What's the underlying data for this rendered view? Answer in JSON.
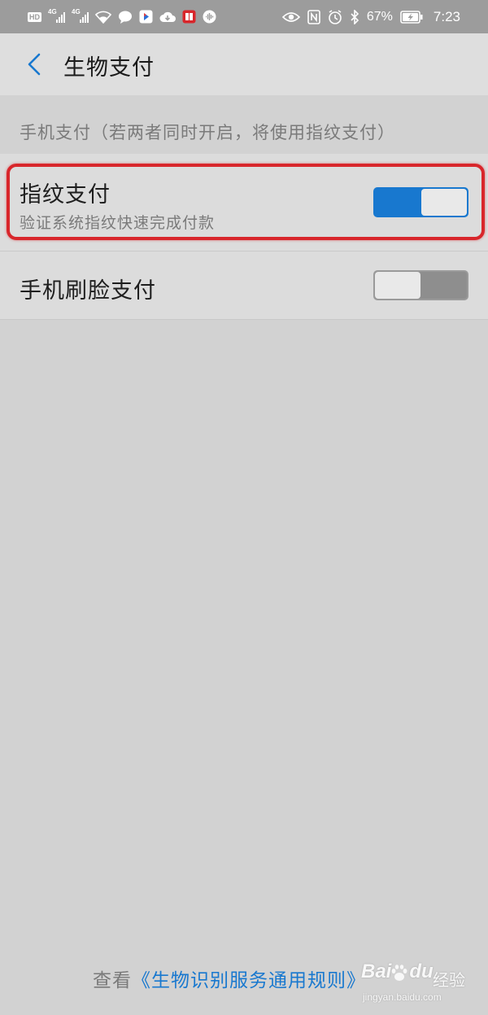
{
  "status_bar": {
    "hd_label": "HD",
    "network_1": "4G",
    "network_2": "4G",
    "battery_percent": "67%",
    "time": "7:23",
    "icons_left": [
      "hd-icon",
      "signal-icon",
      "signal-icon",
      "wifi-icon",
      "chat-bubble-icon",
      "video-app-icon",
      "cloud-download-icon",
      "book-app-icon",
      "voice-icon"
    ],
    "icons_right": [
      "eye-icon",
      "nfc-icon",
      "alarm-icon",
      "bluetooth-icon",
      "battery-icon"
    ]
  },
  "nav": {
    "title": "生物支付"
  },
  "section": {
    "header": "手机支付（若两者同时开启，将使用指纹支付）"
  },
  "rows": [
    {
      "title": "指纹支付",
      "subtitle": "验证系统指纹快速完成付款",
      "enabled": true
    },
    {
      "title": "手机刷脸支付",
      "enabled": false
    }
  ],
  "footer": {
    "prefix": "查看",
    "link_text": "《生物识别服务通用规则》"
  },
  "watermark": {
    "logo": "Bai",
    "logo_suffix": "du",
    "label": "经验",
    "url": "jingyan.baidu.com"
  },
  "colors": {
    "accent": "#1878cf",
    "highlight": "#d8262b",
    "background": "#d2d2d2",
    "row_background": "#dcdcdc",
    "status_bar": "#9c9c9c"
  }
}
